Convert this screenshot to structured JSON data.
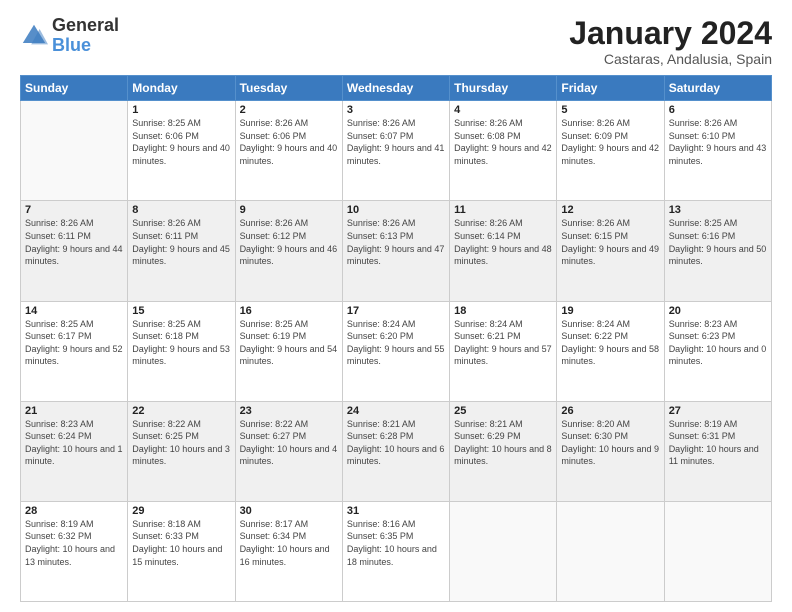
{
  "logo": {
    "text_general": "General",
    "text_blue": "Blue"
  },
  "header": {
    "month_year": "January 2024",
    "location": "Castaras, Andalusia, Spain"
  },
  "days_of_week": [
    "Sunday",
    "Monday",
    "Tuesday",
    "Wednesday",
    "Thursday",
    "Friday",
    "Saturday"
  ],
  "weeks": [
    [
      {
        "day": "",
        "sunrise": "",
        "sunset": "",
        "daylight": "",
        "empty": true
      },
      {
        "day": "1",
        "sunrise": "Sunrise: 8:25 AM",
        "sunset": "Sunset: 6:06 PM",
        "daylight": "Daylight: 9 hours and 40 minutes."
      },
      {
        "day": "2",
        "sunrise": "Sunrise: 8:26 AM",
        "sunset": "Sunset: 6:06 PM",
        "daylight": "Daylight: 9 hours and 40 minutes."
      },
      {
        "day": "3",
        "sunrise": "Sunrise: 8:26 AM",
        "sunset": "Sunset: 6:07 PM",
        "daylight": "Daylight: 9 hours and 41 minutes."
      },
      {
        "day": "4",
        "sunrise": "Sunrise: 8:26 AM",
        "sunset": "Sunset: 6:08 PM",
        "daylight": "Daylight: 9 hours and 42 minutes."
      },
      {
        "day": "5",
        "sunrise": "Sunrise: 8:26 AM",
        "sunset": "Sunset: 6:09 PM",
        "daylight": "Daylight: 9 hours and 42 minutes."
      },
      {
        "day": "6",
        "sunrise": "Sunrise: 8:26 AM",
        "sunset": "Sunset: 6:10 PM",
        "daylight": "Daylight: 9 hours and 43 minutes."
      }
    ],
    [
      {
        "day": "7",
        "sunrise": "Sunrise: 8:26 AM",
        "sunset": "Sunset: 6:11 PM",
        "daylight": "Daylight: 9 hours and 44 minutes."
      },
      {
        "day": "8",
        "sunrise": "Sunrise: 8:26 AM",
        "sunset": "Sunset: 6:11 PM",
        "daylight": "Daylight: 9 hours and 45 minutes."
      },
      {
        "day": "9",
        "sunrise": "Sunrise: 8:26 AM",
        "sunset": "Sunset: 6:12 PM",
        "daylight": "Daylight: 9 hours and 46 minutes."
      },
      {
        "day": "10",
        "sunrise": "Sunrise: 8:26 AM",
        "sunset": "Sunset: 6:13 PM",
        "daylight": "Daylight: 9 hours and 47 minutes."
      },
      {
        "day": "11",
        "sunrise": "Sunrise: 8:26 AM",
        "sunset": "Sunset: 6:14 PM",
        "daylight": "Daylight: 9 hours and 48 minutes."
      },
      {
        "day": "12",
        "sunrise": "Sunrise: 8:26 AM",
        "sunset": "Sunset: 6:15 PM",
        "daylight": "Daylight: 9 hours and 49 minutes."
      },
      {
        "day": "13",
        "sunrise": "Sunrise: 8:25 AM",
        "sunset": "Sunset: 6:16 PM",
        "daylight": "Daylight: 9 hours and 50 minutes."
      }
    ],
    [
      {
        "day": "14",
        "sunrise": "Sunrise: 8:25 AM",
        "sunset": "Sunset: 6:17 PM",
        "daylight": "Daylight: 9 hours and 52 minutes."
      },
      {
        "day": "15",
        "sunrise": "Sunrise: 8:25 AM",
        "sunset": "Sunset: 6:18 PM",
        "daylight": "Daylight: 9 hours and 53 minutes."
      },
      {
        "day": "16",
        "sunrise": "Sunrise: 8:25 AM",
        "sunset": "Sunset: 6:19 PM",
        "daylight": "Daylight: 9 hours and 54 minutes."
      },
      {
        "day": "17",
        "sunrise": "Sunrise: 8:24 AM",
        "sunset": "Sunset: 6:20 PM",
        "daylight": "Daylight: 9 hours and 55 minutes."
      },
      {
        "day": "18",
        "sunrise": "Sunrise: 8:24 AM",
        "sunset": "Sunset: 6:21 PM",
        "daylight": "Daylight: 9 hours and 57 minutes."
      },
      {
        "day": "19",
        "sunrise": "Sunrise: 8:24 AM",
        "sunset": "Sunset: 6:22 PM",
        "daylight": "Daylight: 9 hours and 58 minutes."
      },
      {
        "day": "20",
        "sunrise": "Sunrise: 8:23 AM",
        "sunset": "Sunset: 6:23 PM",
        "daylight": "Daylight: 10 hours and 0 minutes."
      }
    ],
    [
      {
        "day": "21",
        "sunrise": "Sunrise: 8:23 AM",
        "sunset": "Sunset: 6:24 PM",
        "daylight": "Daylight: 10 hours and 1 minute."
      },
      {
        "day": "22",
        "sunrise": "Sunrise: 8:22 AM",
        "sunset": "Sunset: 6:25 PM",
        "daylight": "Daylight: 10 hours and 3 minutes."
      },
      {
        "day": "23",
        "sunrise": "Sunrise: 8:22 AM",
        "sunset": "Sunset: 6:27 PM",
        "daylight": "Daylight: 10 hours and 4 minutes."
      },
      {
        "day": "24",
        "sunrise": "Sunrise: 8:21 AM",
        "sunset": "Sunset: 6:28 PM",
        "daylight": "Daylight: 10 hours and 6 minutes."
      },
      {
        "day": "25",
        "sunrise": "Sunrise: 8:21 AM",
        "sunset": "Sunset: 6:29 PM",
        "daylight": "Daylight: 10 hours and 8 minutes."
      },
      {
        "day": "26",
        "sunrise": "Sunrise: 8:20 AM",
        "sunset": "Sunset: 6:30 PM",
        "daylight": "Daylight: 10 hours and 9 minutes."
      },
      {
        "day": "27",
        "sunrise": "Sunrise: 8:19 AM",
        "sunset": "Sunset: 6:31 PM",
        "daylight": "Daylight: 10 hours and 11 minutes."
      }
    ],
    [
      {
        "day": "28",
        "sunrise": "Sunrise: 8:19 AM",
        "sunset": "Sunset: 6:32 PM",
        "daylight": "Daylight: 10 hours and 13 minutes."
      },
      {
        "day": "29",
        "sunrise": "Sunrise: 8:18 AM",
        "sunset": "Sunset: 6:33 PM",
        "daylight": "Daylight: 10 hours and 15 minutes."
      },
      {
        "day": "30",
        "sunrise": "Sunrise: 8:17 AM",
        "sunset": "Sunset: 6:34 PM",
        "daylight": "Daylight: 10 hours and 16 minutes."
      },
      {
        "day": "31",
        "sunrise": "Sunrise: 8:16 AM",
        "sunset": "Sunset: 6:35 PM",
        "daylight": "Daylight: 10 hours and 18 minutes."
      },
      {
        "day": "",
        "sunrise": "",
        "sunset": "",
        "daylight": "",
        "empty": true
      },
      {
        "day": "",
        "sunrise": "",
        "sunset": "",
        "daylight": "",
        "empty": true
      },
      {
        "day": "",
        "sunrise": "",
        "sunset": "",
        "daylight": "",
        "empty": true
      }
    ]
  ]
}
